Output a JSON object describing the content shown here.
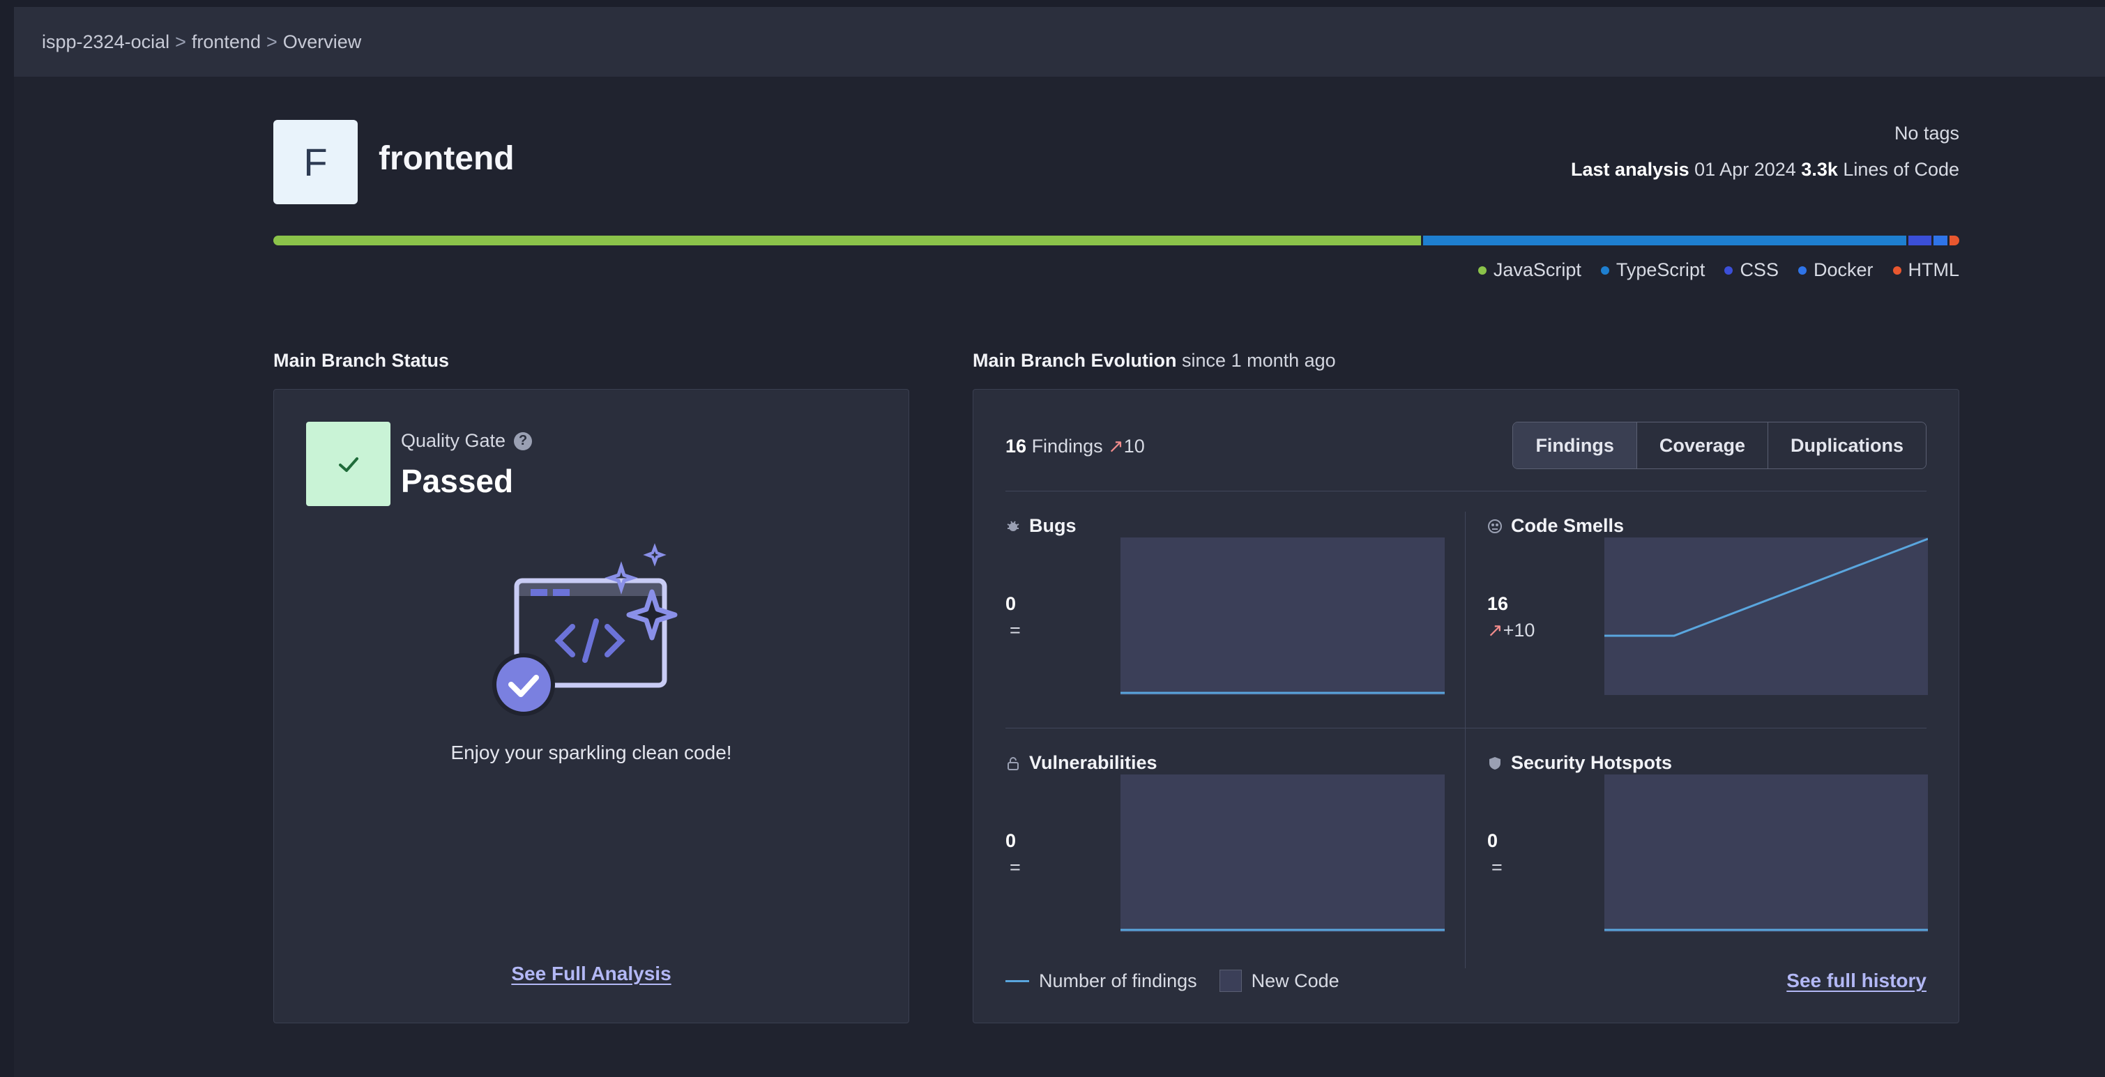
{
  "breadcrumb": {
    "org": "ispp-2324-ocial",
    "project": "frontend",
    "page": "Overview",
    "separator": ">"
  },
  "project": {
    "avatar_letter": "F",
    "name": "frontend",
    "tags": "No tags",
    "last_analysis_label": "Last analysis",
    "last_analysis_date": "01 Apr 2024",
    "loc_value": "3.3k",
    "loc_label": "Lines of Code"
  },
  "languages": [
    {
      "name": "JavaScript",
      "color": "#8bc34a",
      "share": 0.684
    },
    {
      "name": "TypeScript",
      "color": "#1e7fd0",
      "share": 0.288
    },
    {
      "name": "CSS",
      "color": "#3b4fd8",
      "share": 0.014
    },
    {
      "name": "Docker",
      "color": "#2f74e8",
      "share": 0.008
    },
    {
      "name": "HTML",
      "color": "#e8572f",
      "share": 0.006
    }
  ],
  "status": {
    "section_title": "Main Branch Status",
    "quality_gate_label": "Quality Gate",
    "help_glyph": "?",
    "quality_gate_status": "Passed",
    "message": "Enjoy your sparkling clean code!",
    "link": "See Full Analysis"
  },
  "evolution": {
    "section_title": "Main Branch Evolution",
    "section_subtitle": "since 1 month ago",
    "findings_count": "16",
    "findings_label": "Findings",
    "findings_delta": "10",
    "tabs": [
      "Findings",
      "Coverage",
      "Duplications"
    ],
    "metrics": {
      "bugs": {
        "title": "Bugs",
        "value": "0",
        "delta": "="
      },
      "code_smells": {
        "title": "Code Smells",
        "value": "16",
        "delta": "+10"
      },
      "vulnerabilities": {
        "title": "Vulnerabilities",
        "value": "0",
        "delta": "="
      },
      "hotspots": {
        "title": "Security Hotspots",
        "value": "0",
        "delta": "="
      }
    },
    "legend_line": "Number of findings",
    "legend_box": "New Code",
    "link": "See full history"
  },
  "colors": {
    "accent_link": "#b3b8f5",
    "passed_bg": "#c9f3d6",
    "trend_up": "#f28c8c",
    "spark_line": "#5aa6de"
  }
}
